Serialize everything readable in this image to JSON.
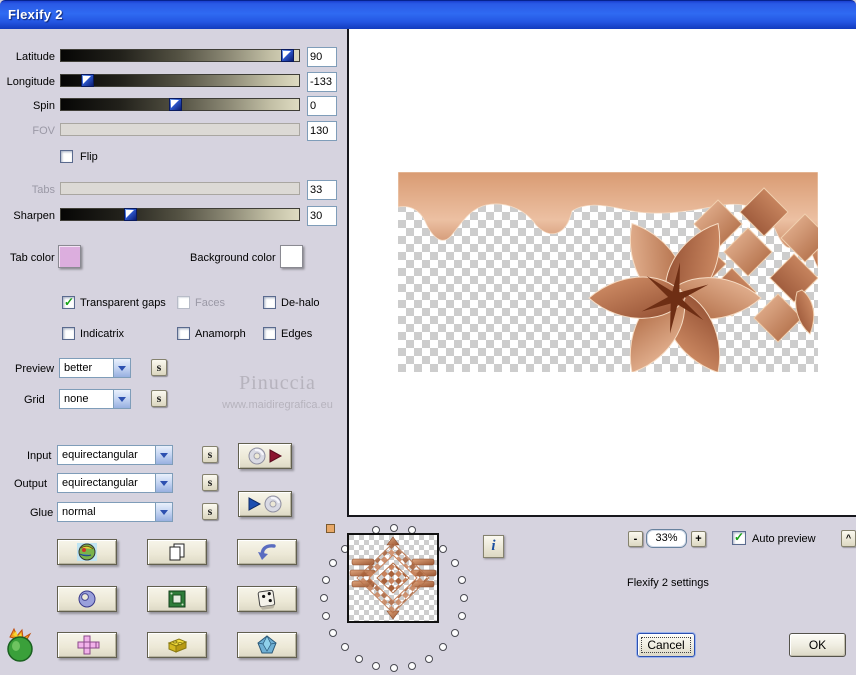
{
  "window": {
    "title": "Flexify 2"
  },
  "sliders": [
    {
      "label": "Latitude",
      "value": "90",
      "pos": 95,
      "disabled": false
    },
    {
      "label": "Longitude",
      "value": "-133",
      "pos": 11,
      "disabled": false
    },
    {
      "label": "Spin",
      "value": "0",
      "pos": 48,
      "disabled": false
    },
    {
      "label": "FOV",
      "value": "130",
      "pos": 0,
      "disabled": true
    },
    {
      "label": "Tabs",
      "value": "33",
      "pos": 0,
      "disabled": true
    },
    {
      "label": "Sharpen",
      "value": "30",
      "pos": 29,
      "disabled": false
    }
  ],
  "flip": {
    "label": "Flip",
    "checked": false
  },
  "swatches": {
    "tab_label": "Tab color",
    "tab_color": "#dcaede",
    "background_label": "Background color",
    "background_color": "#ffffff"
  },
  "options": [
    {
      "label": "Transparent gaps",
      "checked": true,
      "disabled": false
    },
    {
      "label": "Faces",
      "checked": false,
      "disabled": true
    },
    {
      "label": "De-halo",
      "checked": false,
      "disabled": false
    },
    {
      "label": "Indicatrix",
      "checked": false,
      "disabled": false
    },
    {
      "label": "Anamorph",
      "checked": false,
      "disabled": false
    },
    {
      "label": "Edges",
      "checked": false,
      "disabled": false
    }
  ],
  "selects": {
    "preview": {
      "label": "Preview",
      "value": "better"
    },
    "grid": {
      "label": "Grid",
      "value": "none"
    },
    "input": {
      "label": "Input",
      "value": "equirectangular"
    },
    "output": {
      "label": "Output",
      "value": "equirectangular"
    },
    "glue": {
      "label": "Glue",
      "value": "normal"
    }
  },
  "s_button": "s",
  "watermark": {
    "name": "Pinuccia",
    "url": "www.maidiregrafica.eu"
  },
  "zoom_bar": {
    "minus": "-",
    "level": "33%",
    "plus": "+",
    "auto_label": "Auto preview",
    "auto_checked": true,
    "collapse": "^"
  },
  "status": "Flexify 2 settings",
  "info_button": "i",
  "actions": {
    "cancel": "Cancel",
    "ok": "OK"
  },
  "dial": {
    "dots": 24
  },
  "colors": {
    "title_bar": "#2f6af2",
    "panel_bg": "#d6d3df",
    "copper_light": "#ecbd9d",
    "copper_mid": "#c9835c",
    "copper_dark": "#8e4a2e",
    "flower_center": "#6e2e14",
    "check_green": "#17a317",
    "input_border": "#7f9db9"
  }
}
